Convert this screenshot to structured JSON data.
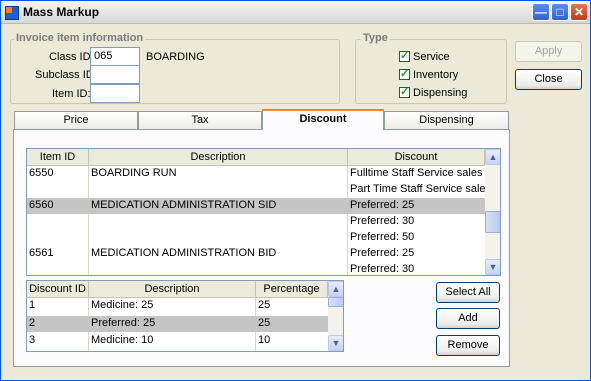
{
  "window": {
    "title": "Mass Markup"
  },
  "invoice_group": {
    "label": "Invoice item information",
    "class_id_label": "Class ID:",
    "class_id_value": "065",
    "class_name": "BOARDING",
    "subclass_id_label": "Subclass ID:",
    "subclass_id_value": "",
    "item_id_label": "Item ID:",
    "item_id_value": ""
  },
  "type_group": {
    "label": "Type",
    "service": "Service",
    "inventory": "Inventory",
    "dispensing": "Dispensing"
  },
  "buttons": {
    "apply": "Apply",
    "close": "Close",
    "select_all": "Select All",
    "add": "Add",
    "remove": "Remove"
  },
  "tabs": {
    "price": "Price",
    "tax": "Tax",
    "discount": "Discount",
    "dispensing": "Dispensing"
  },
  "items_grid": {
    "headers": {
      "item_id": "Item ID",
      "description": "Description",
      "discount": "Discount"
    },
    "rows": [
      {
        "item_id": "6550",
        "description": "BOARDING RUN",
        "discount": "Fulltime Staff Service sales"
      },
      {
        "item_id": "",
        "description": "",
        "discount": "Part Time Staff Service sales"
      },
      {
        "item_id": "6560",
        "description": "MEDICATION ADMINISTRATION SID",
        "discount": "Preferred: 25"
      },
      {
        "item_id": "",
        "description": "",
        "discount": "Preferred: 30"
      },
      {
        "item_id": "",
        "description": "",
        "discount": "Preferred: 50"
      },
      {
        "item_id": "6561",
        "description": "MEDICATION ADMINISTRATION BID",
        "discount": "Preferred: 25"
      },
      {
        "item_id": "",
        "description": "",
        "discount": "Preferred: 30"
      }
    ]
  },
  "discount_grid": {
    "headers": {
      "discount_id": "Discount ID",
      "description": "Description",
      "percentage": "Percentage"
    },
    "rows": [
      {
        "discount_id": "1",
        "description": "Medicine: 25",
        "percentage": "25"
      },
      {
        "discount_id": "2",
        "description": "Preferred: 25",
        "percentage": "25"
      },
      {
        "discount_id": "3",
        "description": "Medicine: 10",
        "percentage": "10"
      }
    ]
  }
}
